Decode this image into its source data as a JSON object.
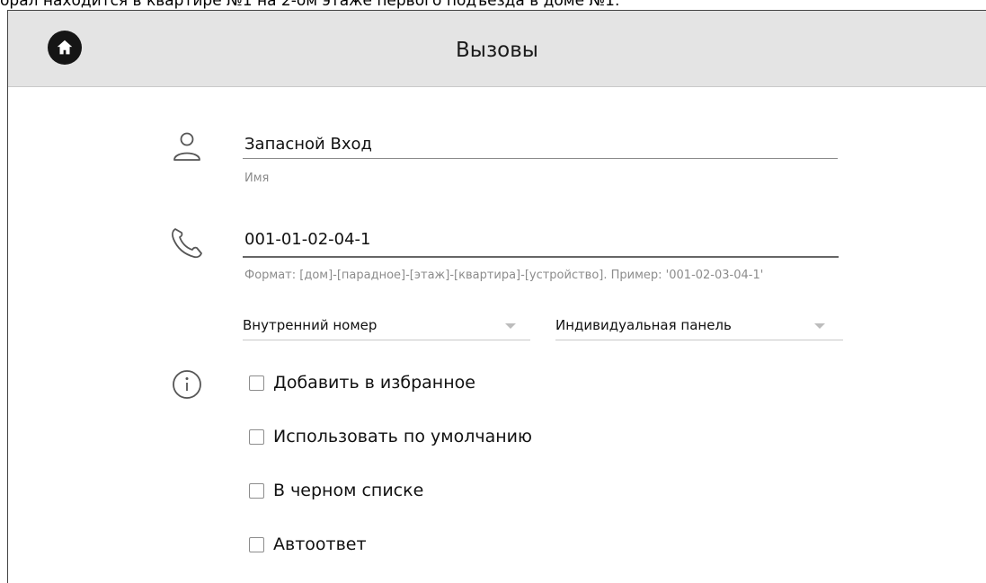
{
  "caption": "орал находится в квартире №1 на 2-ом этаже первого подъезда в доме №1.",
  "header": {
    "title": "Вызовы"
  },
  "name_field": {
    "value": "Запасной Вход",
    "hint": "Имя"
  },
  "number_field": {
    "value": "001-01-02-04-1",
    "hint": "Формат: [дом]-[парадное]-[этаж]-[квартира]-[устройство]. Пример: '001-02-03-04-1'"
  },
  "selects": {
    "number_type": "Внутренний номер",
    "device_type": "Индивидуальная панель"
  },
  "options": [
    {
      "label": "Добавить в избранное",
      "checked": false
    },
    {
      "label": "Использовать по умолчанию",
      "checked": false
    },
    {
      "label": "В черном списке",
      "checked": false
    },
    {
      "label": "Автоответ",
      "checked": false
    }
  ],
  "icons": {
    "home": "home-icon",
    "person": "person-icon",
    "phone": "phone-icon",
    "info": "info-icon"
  },
  "colors": {
    "header_bg": "#e4e4e4",
    "home_button": "#151515",
    "hint": "#8c8c8c"
  }
}
